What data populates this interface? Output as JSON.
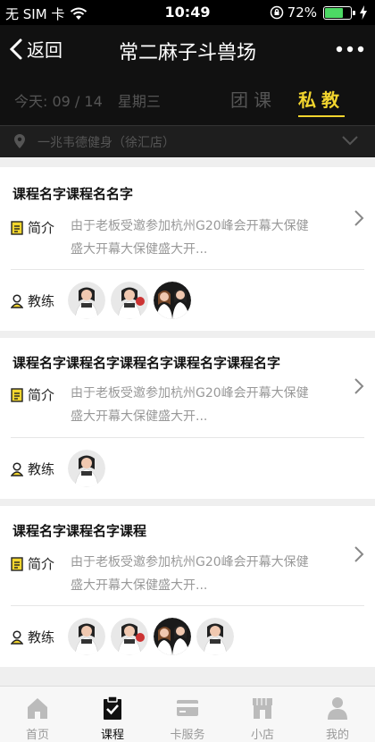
{
  "status": {
    "carrier": "无 SIM 卡",
    "time": "10:49",
    "battery": "72%",
    "battery_level": 0.72
  },
  "nav": {
    "back": "返回",
    "title": "常二麻子斗兽场"
  },
  "datebar": {
    "date": "今天: 09 / 14",
    "weekday": "星期三",
    "tab_group": "团课",
    "tab_private": "私教"
  },
  "store": {
    "name": "一兆韦德健身（徐汇店）"
  },
  "cards": [
    {
      "title": "课程名字课程名名字",
      "intro_label": "简介",
      "desc_line1": "由于老板受邀参加杭州G20峰会开幕大保健",
      "desc_line2": "盛大开幕大保健盛大开...",
      "coach_label": "教练"
    },
    {
      "title": "课程名字课程名字课程名字课程名字课程名字",
      "intro_label": "简介",
      "desc_line1": "由于老板受邀参加杭州G20峰会开幕大保健",
      "desc_line2": "盛大开幕大保健盛大开...",
      "coach_label": "教练"
    },
    {
      "title": "课程名字课程名字课程",
      "intro_label": "简介",
      "desc_line1": "由于老板受邀参加杭州G20峰会开幕大保健",
      "desc_line2": "盛大开幕大保健盛大开...",
      "coach_label": "教练"
    }
  ],
  "tabbar": {
    "home": "首页",
    "course": "课程",
    "card": "卡服务",
    "shop": "小店",
    "me": "我的"
  },
  "colors": {
    "accent": "#f2d52e",
    "dark": "#111111"
  }
}
